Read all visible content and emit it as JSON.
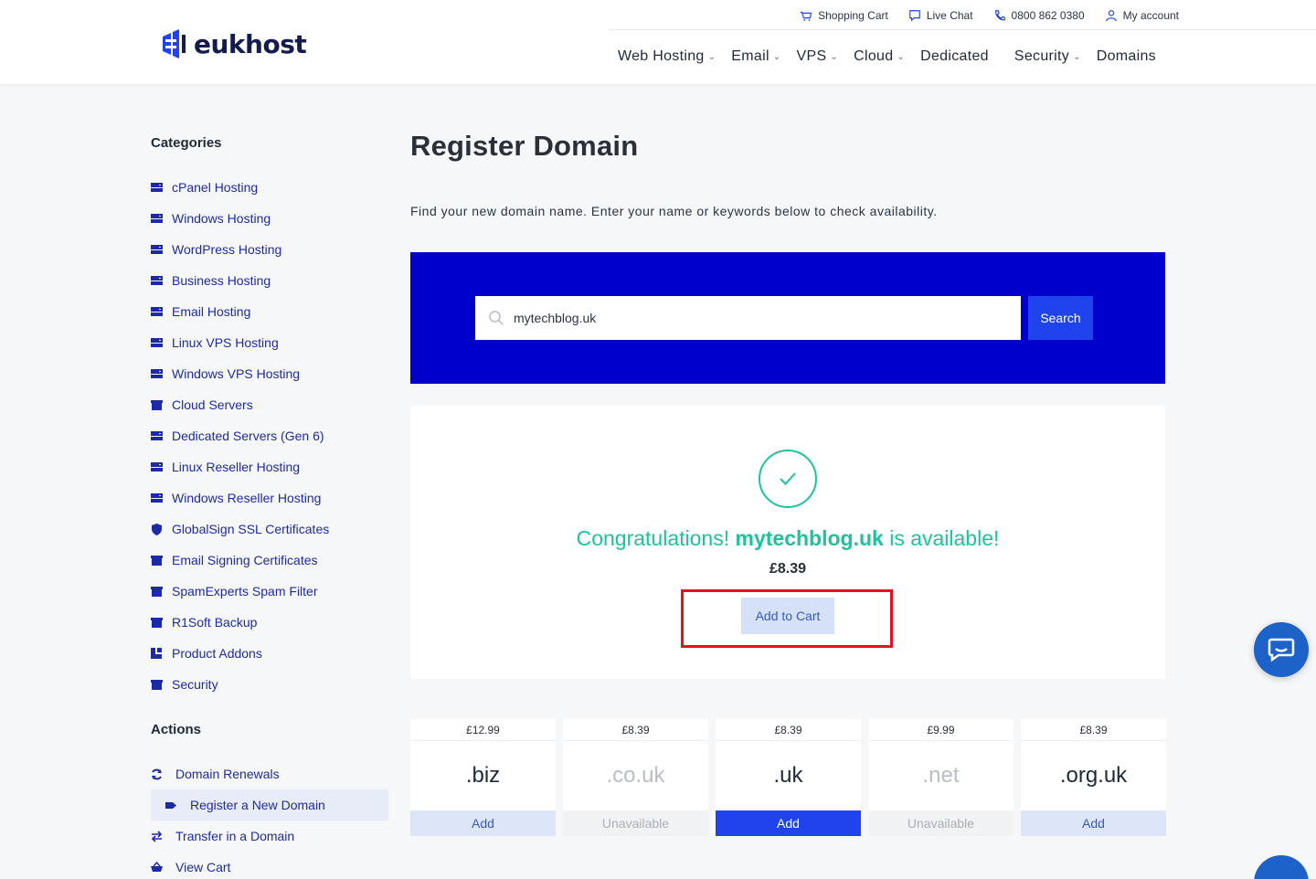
{
  "header": {
    "logo_text": "eukhost",
    "topbar": [
      {
        "icon": "cart-icon",
        "label": "Shopping Cart"
      },
      {
        "icon": "chat-icon",
        "label": "Live Chat"
      },
      {
        "icon": "phone-icon",
        "label": "0800 862 0380"
      },
      {
        "icon": "user-icon",
        "label": "My account"
      }
    ],
    "nav": [
      {
        "label": "Web Hosting",
        "dropdown": true
      },
      {
        "label": "Email",
        "dropdown": true
      },
      {
        "label": "VPS",
        "dropdown": true
      },
      {
        "label": "Cloud",
        "dropdown": true
      },
      {
        "label": "Dedicated",
        "dropdown": false
      },
      {
        "label": "Security",
        "dropdown": true
      },
      {
        "label": "Domains",
        "dropdown": false
      }
    ]
  },
  "sidebar": {
    "categories_heading": "Categories",
    "categories": [
      {
        "label": "cPanel Hosting",
        "icon": "server-icon"
      },
      {
        "label": "Windows Hosting",
        "icon": "server-icon"
      },
      {
        "label": "WordPress Hosting",
        "icon": "server-icon"
      },
      {
        "label": "Business Hosting",
        "icon": "server-icon"
      },
      {
        "label": "Email Hosting",
        "icon": "server-icon"
      },
      {
        "label": "Linux VPS Hosting",
        "icon": "server-icon"
      },
      {
        "label": "Windows VPS Hosting",
        "icon": "server-icon"
      },
      {
        "label": "Cloud Servers",
        "icon": "archive-icon"
      },
      {
        "label": "Dedicated Servers (Gen 6)",
        "icon": "server-icon"
      },
      {
        "label": "Linux Reseller Hosting",
        "icon": "server-icon"
      },
      {
        "label": "Windows Reseller Hosting",
        "icon": "server-icon"
      },
      {
        "label": "GlobalSign SSL Certificates",
        "icon": "shield-icon"
      },
      {
        "label": "Email Signing Certificates",
        "icon": "archive-icon"
      },
      {
        "label": "SpamExperts Spam Filter",
        "icon": "archive-icon"
      },
      {
        "label": "R1Soft Backup",
        "icon": "archive-icon"
      },
      {
        "label": "Product Addons",
        "icon": "cubes-icon"
      },
      {
        "label": "Security",
        "icon": "archive-icon"
      }
    ],
    "actions_heading": "Actions",
    "actions": [
      {
        "label": "Domain Renewals",
        "icon": "sync-icon",
        "active": false
      },
      {
        "label": "Register a New Domain",
        "icon": "tag-icon",
        "active": true
      },
      {
        "label": "Transfer in a Domain",
        "icon": "transfer-icon",
        "active": false
      },
      {
        "label": "View Cart",
        "icon": "cart-icon",
        "active": false
      }
    ]
  },
  "main": {
    "title": "Register Domain",
    "intro": "Find your new domain name. Enter your name or keywords below to check availability.",
    "search": {
      "value": "mytechblog.uk",
      "button_label": "Search"
    },
    "result": {
      "congrats_prefix": "Congratulations!",
      "domain": "mytechblog.uk",
      "congrats_suffix": "is available!",
      "price": "£8.39",
      "add_to_cart_label": "Add to Cart"
    },
    "tlds": [
      {
        "price": "£12.99",
        "name": ".biz",
        "status": "add",
        "button": "Add"
      },
      {
        "price": "£8.39",
        "name": ".co.uk",
        "status": "unavailable",
        "button": "Unavailable"
      },
      {
        "price": "£8.39",
        "name": ".uk",
        "status": "selected",
        "button": "Add"
      },
      {
        "price": "£9.99",
        "name": ".net",
        "status": "unavailable",
        "button": "Unavailable"
      },
      {
        "price": "£8.39",
        "name": ".org.uk",
        "status": "add",
        "button": "Add"
      }
    ]
  },
  "colors": {
    "brand_blue": "#0000cc",
    "accent_blue": "#1f44ee",
    "success_green": "#1ec29c",
    "highlight_red": "#e0141e"
  }
}
